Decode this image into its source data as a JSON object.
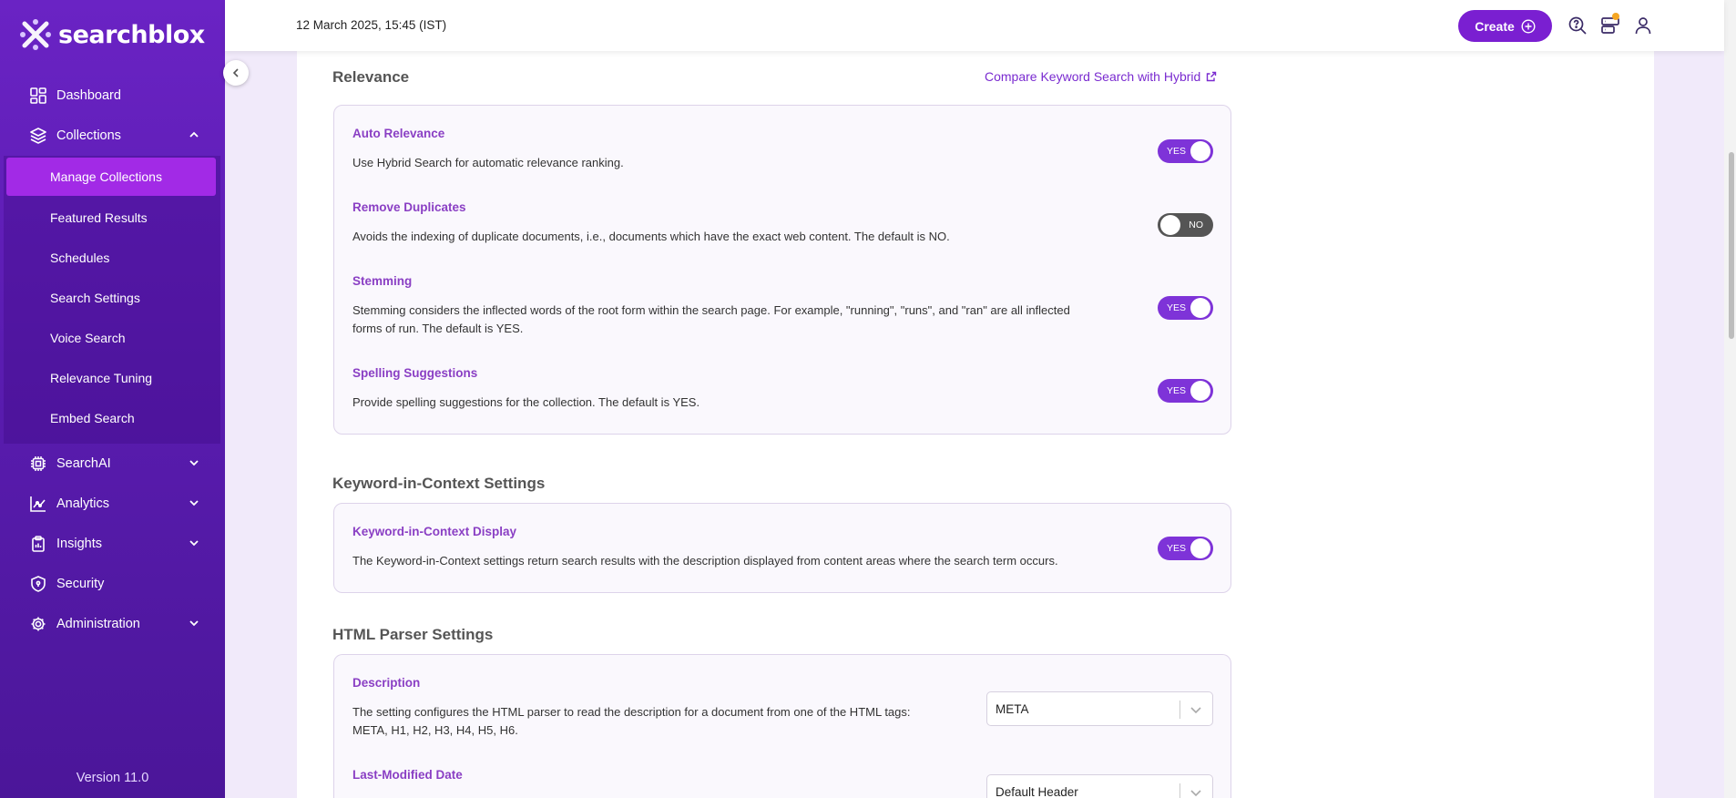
{
  "brand": {
    "name": "searchblox"
  },
  "sidebar": {
    "items": [
      {
        "label": "Dashboard",
        "icon": "dashboard-icon"
      },
      {
        "label": "Collections",
        "icon": "layers-icon",
        "expanded": true,
        "children": [
          {
            "label": "Manage Collections",
            "active": true
          },
          {
            "label": "Featured Results"
          },
          {
            "label": "Schedules"
          },
          {
            "label": "Search Settings"
          },
          {
            "label": "Voice Search"
          },
          {
            "label": "Relevance Tuning"
          },
          {
            "label": "Embed Search"
          }
        ]
      },
      {
        "label": "SearchAI",
        "icon": "chip-icon"
      },
      {
        "label": "Analytics",
        "icon": "analytics-icon"
      },
      {
        "label": "Insights",
        "icon": "clipboard-icon"
      },
      {
        "label": "Security",
        "icon": "shield-icon"
      },
      {
        "label": "Administration",
        "icon": "gear-icon"
      }
    ],
    "version": "Version 11.0"
  },
  "topbar": {
    "datetime": "12 March 2025, 15:45 (IST)",
    "create_label": "Create",
    "icons": [
      "help-search-icon",
      "server-icon",
      "user-icon"
    ]
  },
  "colors": {
    "accent": "#7a1fd1",
    "sidebar": "#5a1cb0",
    "label": "#8a3fc4"
  },
  "relevance": {
    "title": "Relevance",
    "compare_link": "Compare Keyword Search with Hybrid",
    "settings": [
      {
        "label": "Auto Relevance",
        "desc": "Use Hybrid Search for automatic relevance ranking.",
        "toggle": "YES"
      },
      {
        "label": "Remove Duplicates",
        "desc": "Avoids the indexing of duplicate documents, i.e., documents which have the exact web content. The default is NO.",
        "toggle": "NO"
      },
      {
        "label": "Stemming",
        "desc1": "Stemming considers the inflected words of the root form within the search page. For example, \"running\", \"runs\", and \"ran\" are all inflected",
        "desc2": "forms of run. The default is YES.",
        "toggle": "YES"
      },
      {
        "label": "Spelling Suggestions",
        "desc": "Provide spelling suggestions for the collection. The default is YES.",
        "toggle": "YES"
      }
    ]
  },
  "kwic": {
    "title": "Keyword-in-Context Settings",
    "setting": {
      "label": "Keyword-in-Context Display",
      "desc": "The Keyword-in-Context settings return search results with the description displayed from content areas where the search term occurs.",
      "toggle": "YES"
    }
  },
  "html_parser": {
    "title": "HTML Parser Settings",
    "description": {
      "label": "Description",
      "desc1": "The setting configures the HTML parser to read the description for a document from one of the HTML tags:",
      "desc2": "META, H1, H2, H3, H4, H5, H6.",
      "value": "META"
    },
    "last_modified": {
      "label": "Last-Modified Date",
      "value": "Default Header"
    }
  }
}
